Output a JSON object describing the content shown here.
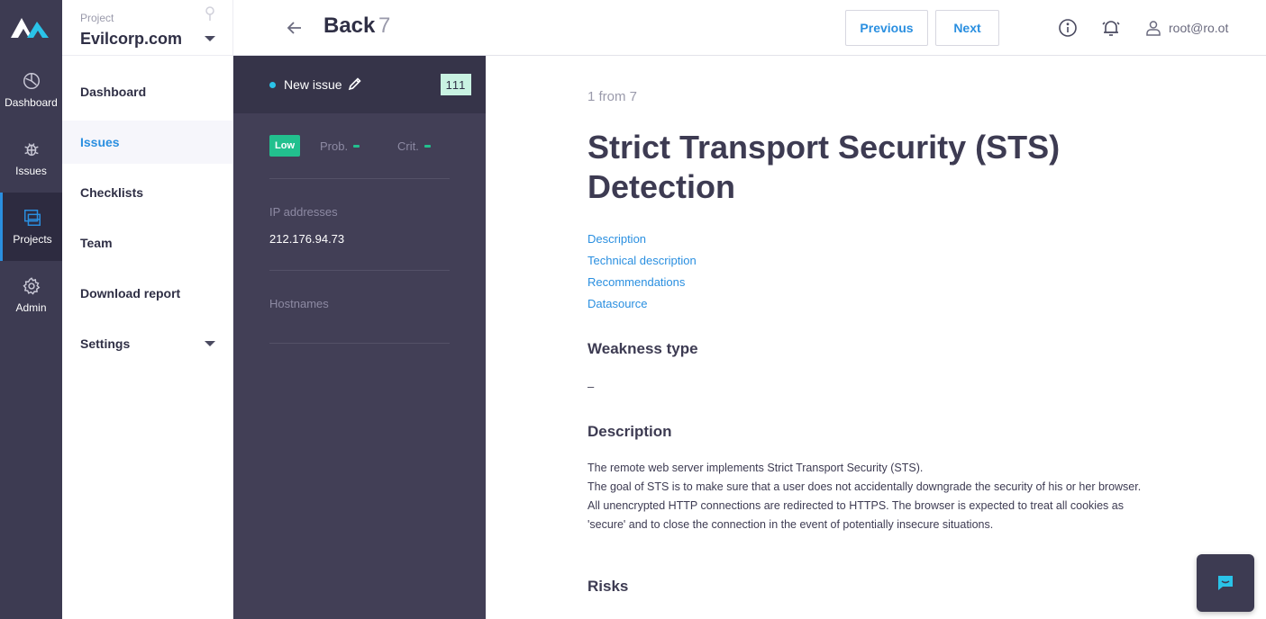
{
  "rail": {
    "items": [
      {
        "label": "Dashboard",
        "icon": "dashboard-icon"
      },
      {
        "label": "Issues",
        "icon": "bug-icon"
      },
      {
        "label": "Projects",
        "icon": "projects-icon"
      },
      {
        "label": "Admin",
        "icon": "gear-icon"
      }
    ],
    "active": "Projects"
  },
  "project": {
    "label": "Project",
    "name": "Evilcorp.com"
  },
  "nav": {
    "items": [
      {
        "label": "Dashboard"
      },
      {
        "label": "Issues"
      },
      {
        "label": "Checklists"
      },
      {
        "label": "Team"
      },
      {
        "label": "Download report"
      },
      {
        "label": "Settings"
      }
    ],
    "active": "Issues"
  },
  "header": {
    "back_label": "Back",
    "back_count": "7",
    "previous_label": "Previous",
    "next_label": "Next",
    "user": "root@ro.ot"
  },
  "issue_panel": {
    "name": "New issue",
    "id": "111",
    "severity": "Low",
    "prob_label": "Prob.",
    "crit_label": "Crit.",
    "ip_label": "IP addresses",
    "ip_value": "212.176.94.73",
    "hostnames_label": "Hostnames"
  },
  "content": {
    "counter": "1 from 7",
    "title": "Strict Transport Security (STS) Detection",
    "toc": [
      "Description",
      "Technical description",
      "Recommendations",
      "Datasource"
    ],
    "weakness_heading": "Weakness type",
    "weakness_value": "–",
    "description_heading": "Description",
    "description": [
      "The remote web server implements Strict Transport Security (STS).",
      "The goal of STS is to make sure that a user does not accidentally downgrade the security of his or her browser.",
      "All unencrypted HTTP connections are redirected to HTTPS. The browser is expected to treat all cookies as 'secure' and to close the connection in the event of potentially insecure situations."
    ],
    "risks_heading": "Risks"
  },
  "colors": {
    "accent": "#2a8fe0",
    "rail_bg": "#3d3b52",
    "panel_bg": "#423f56",
    "severity_low": "#22c08e",
    "id_badge": "#c9f2e2"
  }
}
